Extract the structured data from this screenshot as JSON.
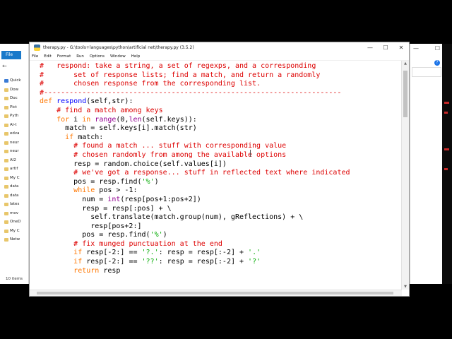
{
  "explorer": {
    "file_tab": "File",
    "nav_arrows": "←",
    "items": [
      "Quick",
      "Dow",
      "Doc",
      "Pict",
      "Pyth",
      "AI-t",
      "edva",
      "neur",
      "neur",
      "AI2",
      "artif",
      "My C",
      "data",
      "data",
      "lates",
      "mov",
      "OneD",
      "My C",
      "Netw"
    ],
    "status": "10 items"
  },
  "bg_window": {
    "minimize": "—",
    "maximize": "☐",
    "close": "✕"
  },
  "editor": {
    "title": "therapy.py - G:\\tools+languages\\python\\artificial net\\therapy.py (3.5.2)",
    "window_buttons": {
      "minimize": "—",
      "maximize": "☐",
      "close": "✕"
    },
    "menu": [
      "File",
      "Edit",
      "Format",
      "Run",
      "Options",
      "Window",
      "Help"
    ]
  },
  "code_lines": [
    [
      [
        "cm",
        "#   respond: take a string, a set of regexps, and a corresponding"
      ]
    ],
    [
      [
        "cm",
        "#       set of response lists; find a match, and return a randomly"
      ]
    ],
    [
      [
        "cm",
        "#       chosen response from the corresponding list."
      ]
    ],
    [
      [
        "cm",
        "#----------------------------------------------------------------------"
      ]
    ],
    [
      [
        "kw",
        "def "
      ],
      [
        "df",
        "respond"
      ],
      [
        "",
        "(self,str):"
      ]
    ],
    [
      [
        "",
        "    "
      ],
      [
        "cm",
        "# find a match among keys"
      ]
    ],
    [
      [
        "",
        "    "
      ],
      [
        "kw",
        "for"
      ],
      [
        "",
        " i "
      ],
      [
        "kw",
        "in"
      ],
      [
        "",
        " "
      ],
      [
        "bi",
        "range"
      ],
      [
        "",
        "(0,"
      ],
      [
        "bi",
        "len"
      ],
      [
        "",
        "(self.keys)):"
      ]
    ],
    [
      [
        "",
        "      match = self.keys[i].match(str)"
      ]
    ],
    [
      [
        "",
        "      "
      ],
      [
        "kw",
        "if"
      ],
      [
        "",
        " match:"
      ]
    ],
    [
      [
        "",
        "        "
      ],
      [
        "cm",
        "# found a match ... stuff with corresponding value"
      ]
    ],
    [
      [
        "",
        "        "
      ],
      [
        "cm",
        "# chosen randomly from among the available options"
      ]
    ],
    [
      [
        "",
        "        resp = random.choice(self.values[i])"
      ]
    ],
    [
      [
        "",
        "        "
      ],
      [
        "cm",
        "# we've got a response... stuff in reflected text where indicated"
      ]
    ],
    [
      [
        "",
        "        pos = resp.find("
      ],
      [
        "st",
        "'%'"
      ],
      [
        "",
        ")"
      ]
    ],
    [
      [
        "",
        "        "
      ],
      [
        "kw",
        "while"
      ],
      [
        "",
        " pos > -1:"
      ]
    ],
    [
      [
        "",
        "          num = "
      ],
      [
        "bi",
        "int"
      ],
      [
        "",
        "(resp[pos+1:pos+2])"
      ]
    ],
    [
      [
        "",
        "          resp = resp[:pos] + \\"
      ]
    ],
    [
      [
        "",
        "            self.translate(match.group(num), gReflections) + \\"
      ]
    ],
    [
      [
        "",
        "            resp[pos+2:]"
      ]
    ],
    [
      [
        "",
        "          pos = resp.find("
      ],
      [
        "st",
        "'%'"
      ],
      [
        "",
        ")"
      ]
    ],
    [
      [
        "",
        "        "
      ],
      [
        "cm",
        "# fix munged punctuation at the end"
      ]
    ],
    [
      [
        "",
        "        "
      ],
      [
        "kw",
        "if"
      ],
      [
        "",
        " resp[-2:] == "
      ],
      [
        "st",
        "'?.'"
      ],
      [
        "",
        ": resp = resp[:-2] + "
      ],
      [
        "st",
        "'.'"
      ]
    ],
    [
      [
        "",
        "        "
      ],
      [
        "kw",
        "if"
      ],
      [
        "",
        " resp[-2:] == "
      ],
      [
        "st",
        "'??'"
      ],
      [
        "",
        ": resp = resp[:-2] + "
      ],
      [
        "st",
        "'?'"
      ]
    ],
    [
      [
        "",
        "        "
      ],
      [
        "kw",
        "return"
      ],
      [
        "",
        " resp"
      ]
    ],
    [
      [
        "",
        ""
      ]
    ],
    [
      [
        "",
        ""
      ]
    ],
    [
      [
        "cm",
        "#----------------------------------------------------------------------"
      ]
    ]
  ]
}
